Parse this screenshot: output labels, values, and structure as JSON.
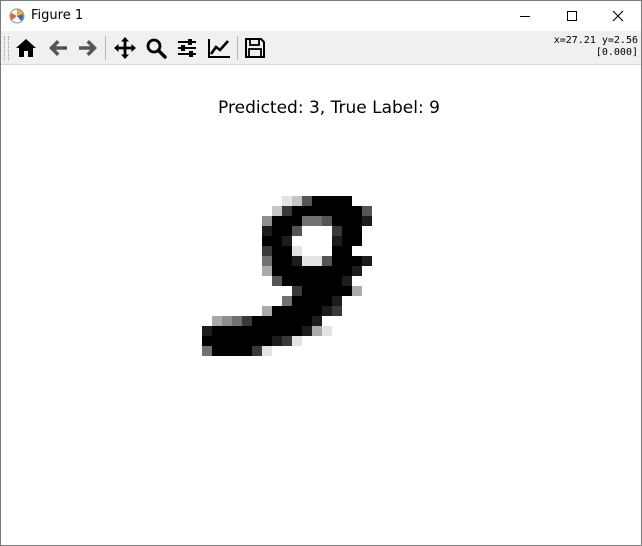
{
  "window": {
    "title": "Figure 1",
    "controls": [
      "minimize",
      "maximize",
      "close"
    ]
  },
  "toolbar": {
    "buttons": [
      {
        "name": "home",
        "icon": "home-icon"
      },
      {
        "name": "back",
        "icon": "arrow-left-icon"
      },
      {
        "name": "forward",
        "icon": "arrow-right-icon"
      },
      {
        "name": "pan",
        "icon": "move-icon"
      },
      {
        "name": "zoom",
        "icon": "zoom-icon"
      },
      {
        "name": "subplots",
        "icon": "sliders-icon"
      },
      {
        "name": "customize",
        "icon": "trend-icon"
      },
      {
        "name": "save",
        "icon": "save-icon"
      }
    ],
    "coords_line1": "x=27.21 y=2.56",
    "coords_line2": "[0.000]"
  },
  "figure": {
    "title": "Predicted: 3, True Label: 9",
    "colormap": "gray_r",
    "image_pixels": {
      "20": [
        0,
        0,
        0,
        0,
        0,
        0,
        0,
        0,
        0,
        0,
        0,
        0,
        0,
        0,
        0,
        0,
        0,
        0,
        0,
        0,
        0,
        0,
        0,
        0,
        0,
        0,
        0,
        0
      ],
      "21": [
        0,
        0,
        0,
        0,
        0,
        0,
        0,
        0,
        0,
        0,
        0,
        0,
        0,
        0,
        0,
        0,
        0,
        0,
        0,
        0,
        0,
        0,
        0,
        0,
        0,
        0,
        0,
        0
      ]
    },
    "digit_rows": [
      "............................",
      "............................",
      "............................",
      "..........1269999......",
      ".........2799999996....",
      "........49995569998.....",
      "........8996000799.......",
      "........9980000899.......",
      "........799100099........",
      "........59981169998.....",
      "........3999999998.......",
      ".........69999998........",
      "...........7999993.......",
      "..........599998.........",
      "........39999987.........",
      "...34579999998...........",
      "..8999999999831..........",
      "..9999999871.............",
      "..5999971................",
      "............................"
    ]
  }
}
